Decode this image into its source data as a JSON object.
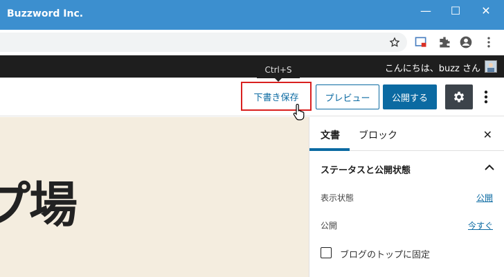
{
  "window": {
    "title": "Buzzword Inc.",
    "minimize": "—",
    "maximize": "☐",
    "close": "✕"
  },
  "adminbar": {
    "greeting": "こんにちは、buzz さん"
  },
  "editor": {
    "tooltip": "Ctrl+S",
    "save_draft_label": "下書き保存",
    "preview_label": "プレビュー",
    "publish_label": "公開する"
  },
  "canvas": {
    "heading_visible": "プ場"
  },
  "sidebar": {
    "tabs": [
      {
        "label": "文書"
      },
      {
        "label": "ブロック"
      }
    ],
    "close": "✕",
    "section_title": "ステータスと公開状態",
    "rows": [
      {
        "label": "表示状態",
        "value": "公開"
      },
      {
        "label": "公開",
        "value": "今すぐ"
      }
    ],
    "sticky_label": "ブログのトップに固定"
  },
  "colors": {
    "titlebar": "#3c8fcf",
    "accent": "#0b6aa2",
    "highlight": "#d9201f",
    "canvas_bg": "#f4eddf"
  }
}
